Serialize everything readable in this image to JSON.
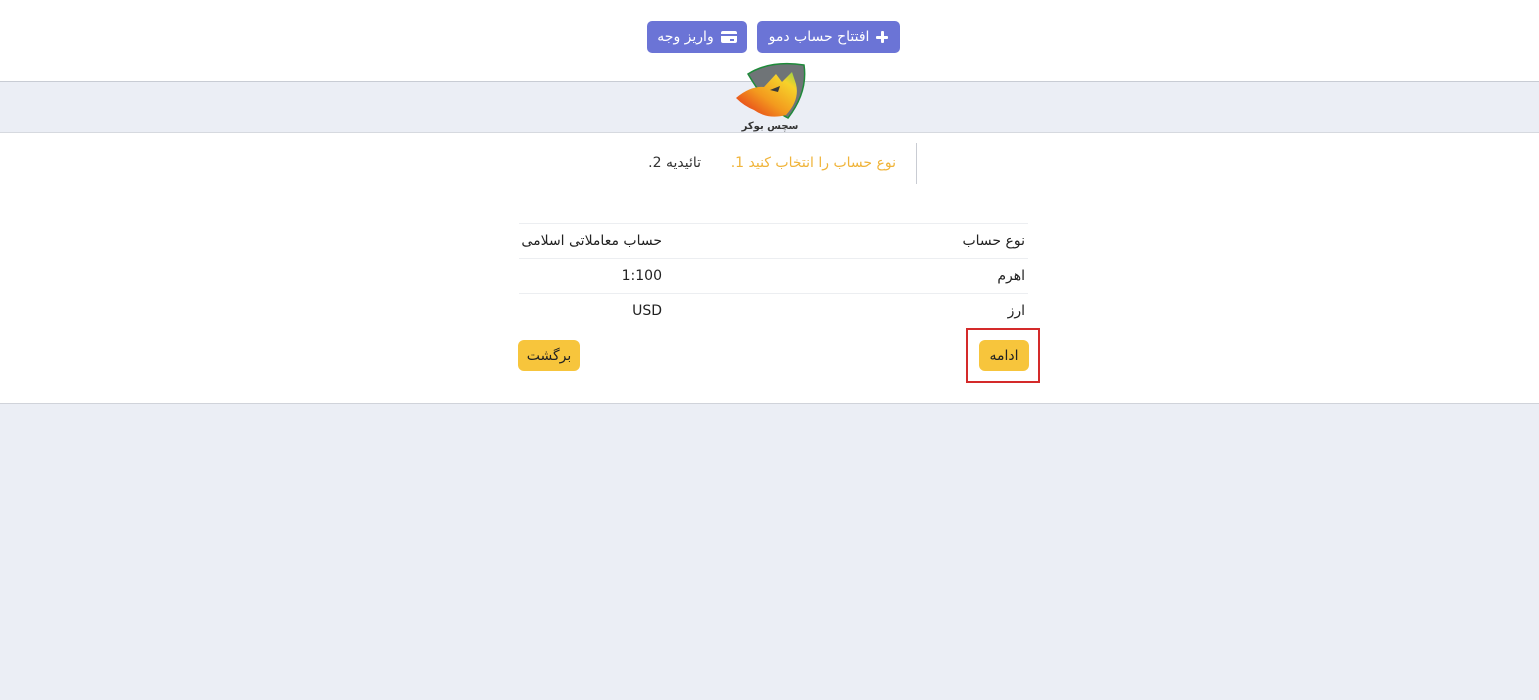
{
  "header": {
    "demo_button": "افتتاح حساب دمو",
    "deposit_button": "واریز وجه"
  },
  "logo": {
    "text": "سچس بوکر"
  },
  "steps": [
    {
      "label": "نوع حساب را انتخاب کنید 1."
    },
    {
      "label": "تائیدیه 2."
    }
  ],
  "summary": {
    "rows": [
      {
        "label": "نوع حساب",
        "value": "حساب معاملاتی اسلامی"
      },
      {
        "label": "اهرم",
        "value": "1:100"
      },
      {
        "label": "ارز",
        "value": "USD"
      }
    ]
  },
  "actions": {
    "continue": "ادامه",
    "back": "برگشت"
  },
  "colors": {
    "primary": "#6b74d6",
    "accent": "#f7c53c",
    "active_step": "#f0b43a",
    "highlight": "#d42a2a",
    "background": "#ebeef5"
  }
}
